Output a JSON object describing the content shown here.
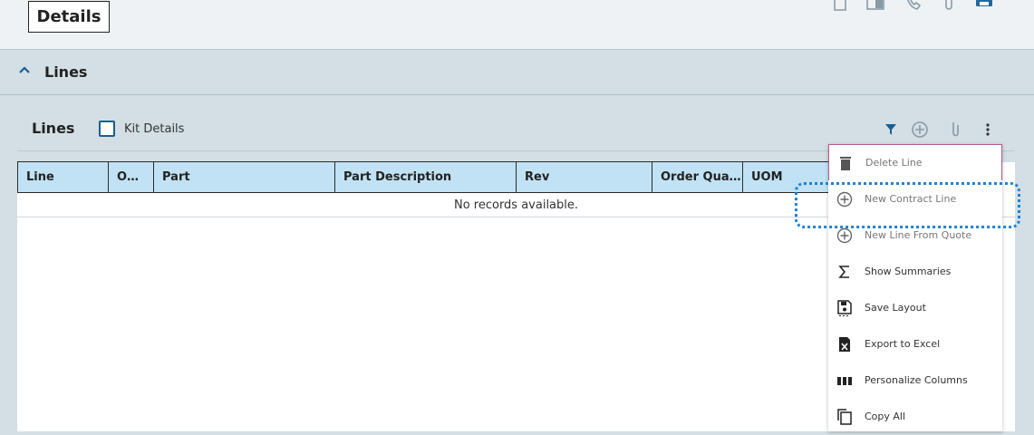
{
  "header": {
    "tab_label": "Details",
    "icons": [
      "document-icon",
      "book-icon",
      "phone-icon",
      "paperclip-icon",
      "printer-icon"
    ]
  },
  "section": {
    "title": "Lines",
    "chevron_icon": "chevron-up-icon"
  },
  "lines_toolbar": {
    "title": "Lines",
    "kit_details_label": "Kit Details",
    "kit_details_checked": false,
    "icons": [
      "filter-icon",
      "add-circle-icon",
      "paperclip-icon",
      "more-vertical-icon"
    ]
  },
  "grid": {
    "columns": [
      "Line",
      "O…",
      "Part",
      "Part Description",
      "Rev",
      "Order Qua…",
      "UOM"
    ],
    "empty_message": "No records available."
  },
  "context_menu": {
    "items": [
      {
        "label": "Delete Line",
        "icon": "trash-icon",
        "enabled": false
      },
      {
        "label": "New Contract Line",
        "icon": "add-circle-icon",
        "enabled": false
      },
      {
        "label": "New Line From Quote",
        "icon": "add-circle-icon",
        "enabled": false
      },
      {
        "label": "Show Summaries",
        "icon": "sigma-icon",
        "enabled": true
      },
      {
        "label": "Save Layout",
        "icon": "save-icon",
        "enabled": true
      },
      {
        "label": "Export to Excel",
        "icon": "excel-icon",
        "enabled": true
      },
      {
        "label": "Personalize Columns",
        "icon": "columns-icon",
        "enabled": true
      },
      {
        "label": "Copy All",
        "icon": "copy-icon",
        "enabled": true
      }
    ]
  },
  "colors": {
    "accent": "#1a5f8e",
    "grid_header": "#c1e2f4",
    "highlight": "#1e82d6",
    "background": "#d3dfe4"
  }
}
